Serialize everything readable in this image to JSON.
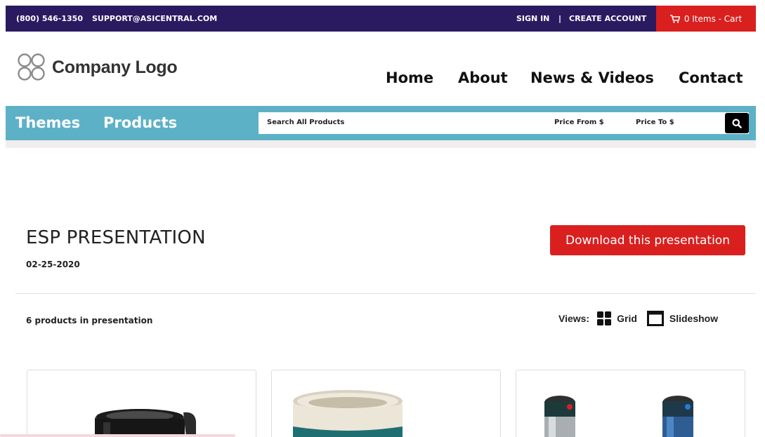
{
  "topbar": {
    "phone": "(800) 546-1350",
    "email": "SUPPORT@ASICENTRAL.COM",
    "sign_in": "SIGN IN",
    "separator": "|",
    "create_account": "CREATE ACCOUNT",
    "cart": "0 Items - Cart",
    "background_color": "#2a1b61",
    "cart_color": "#d9201f"
  },
  "logo": {
    "text": "Company Logo"
  },
  "nav": {
    "home": "Home",
    "about": "About",
    "news": "News & Videos",
    "contact": "Contact"
  },
  "categories": {
    "themes": "Themes",
    "products": "Products",
    "bar_color": "#5db1c7"
  },
  "search": {
    "placeholder": "Search All Products",
    "price_from": "Price From $",
    "price_to": "Price To $",
    "icon": "search-icon"
  },
  "presentation": {
    "title": "ESP PRESENTATION",
    "date": "02-25-2020",
    "download_label": "Download this presentation",
    "product_count": "6 products in presentation"
  },
  "views": {
    "label": "Views:",
    "grid": "Grid",
    "slideshow": "Slideshow",
    "grid_icon": "grid-icon",
    "slideshow_icon": "slideshow-icon"
  },
  "products": [
    {
      "image": "black-travel-mug"
    },
    {
      "image": "cream-teal-tumbler"
    },
    {
      "image": "two-steel-tumblers"
    }
  ]
}
